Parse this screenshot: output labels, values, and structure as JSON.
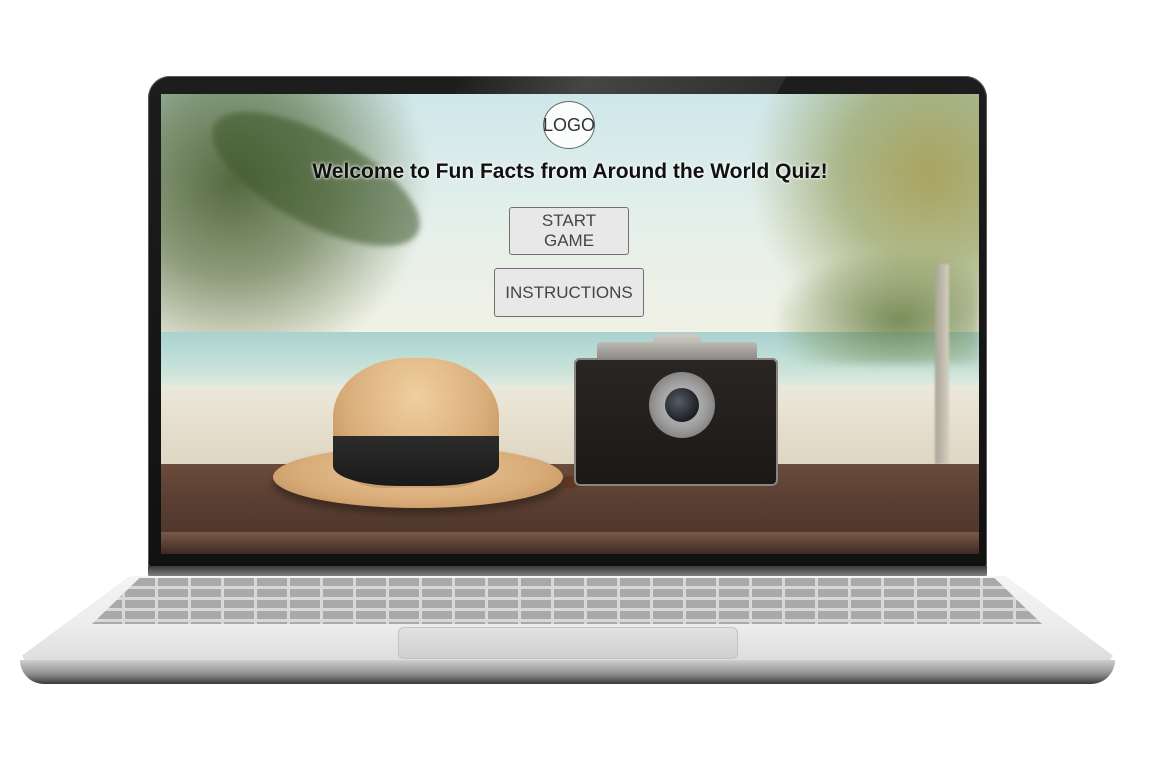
{
  "app": {
    "logo_text": "LOGO",
    "title": "Welcome to Fun Facts from Around the World Quiz!"
  },
  "buttons": {
    "start_label": "START GAME",
    "instructions_label": "INSTRUCTIONS"
  },
  "colors": {
    "title_text": "#111111",
    "button_bg": "#e8e8e8",
    "button_border": "#707070",
    "button_text": "#444444"
  },
  "icons": [
    "laptop-frame",
    "beach-background-image",
    "straw-hat-image",
    "camera-image"
  ]
}
